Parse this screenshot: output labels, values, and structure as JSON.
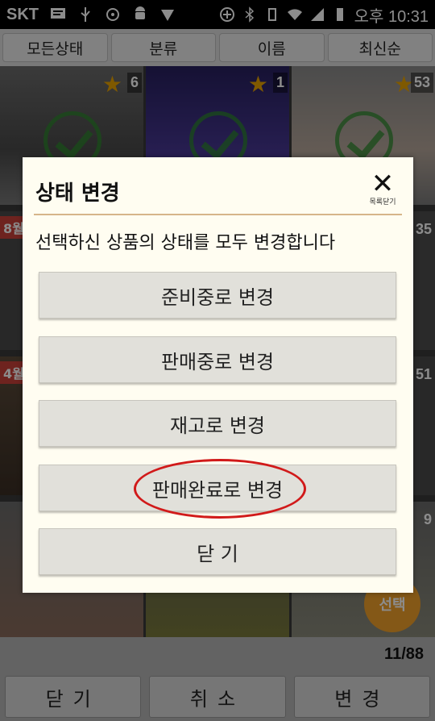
{
  "status_bar": {
    "carrier": "SKT",
    "time": "오후 10:31",
    "icons": [
      "message-icon",
      "usb-icon",
      "sync-icon",
      "android-icon",
      "check-icon",
      "plus-icon",
      "bluetooth-icon",
      "vibrate-icon",
      "wifi-icon",
      "signal-icon",
      "battery-icon"
    ]
  },
  "filter_tabs": [
    "모든상태",
    "분류",
    "이름",
    "최신순"
  ],
  "grid": {
    "badges": [
      "6",
      "1",
      "53"
    ],
    "side_numbers": [
      "35",
      "51",
      "9"
    ],
    "tags": [
      "8월",
      "4월"
    ],
    "select_badge": "선택"
  },
  "count": "11/88",
  "bottom_buttons": [
    "닫기",
    "취소",
    "변경"
  ],
  "dialog": {
    "title": "상태 변경",
    "close_label": "목록닫기",
    "message": "선택하신 상품의 상태를 모두 변경합니다",
    "options": [
      "준비중로 변경",
      "판매중로 변경",
      "재고로 변경",
      "판매완료로 변경"
    ],
    "close_button": "닫 기"
  }
}
